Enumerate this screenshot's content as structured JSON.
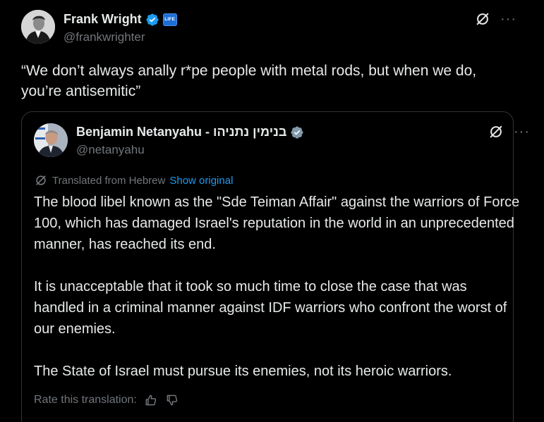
{
  "post": {
    "author": {
      "name": "Frank Wright",
      "handle": "@frankwrighter",
      "badge_text": "LIFE"
    },
    "text": "“We don’t always anally r*pe people with metal rods, but when we do, you’re antisemitic”",
    "more_label": "···"
  },
  "quote": {
    "author": {
      "name": "Benjamin Netanyahu - בנימין נתניהו",
      "handle": "@netanyahu"
    },
    "more_label": "···",
    "translated_label": "Translated from Hebrew",
    "show_original_label": "Show original",
    "paragraphs": [
      "The blood libel known as the \"Sde Teiman Affair\" against the warriors of Force 100, which has damaged Israel's reputation in the world in an unprecedented manner, has reached its end.",
      "It is unacceptable that it took so much time to close the case that was handled in a criminal manner against IDF warriors who confront the worst of our enemies.",
      "The State of Israel must pursue its enemies, not its heroic warriors."
    ],
    "rate_label": "Rate this translation:"
  },
  "colors": {
    "background": "#000000",
    "text_primary": "#e7e9ea",
    "text_secondary": "#71767b",
    "verified_blue": "#1d9bf0",
    "verified_gray": "#829aab",
    "border": "#2f3336"
  },
  "icons": {
    "verified": "verified-badge-icon",
    "gov_verified": "gray-verified-badge-icon",
    "grok": "grok-icon",
    "translate": "translate-icon",
    "thumbs_up": "thumbs-up-icon",
    "thumbs_down": "thumbs-down-icon"
  }
}
